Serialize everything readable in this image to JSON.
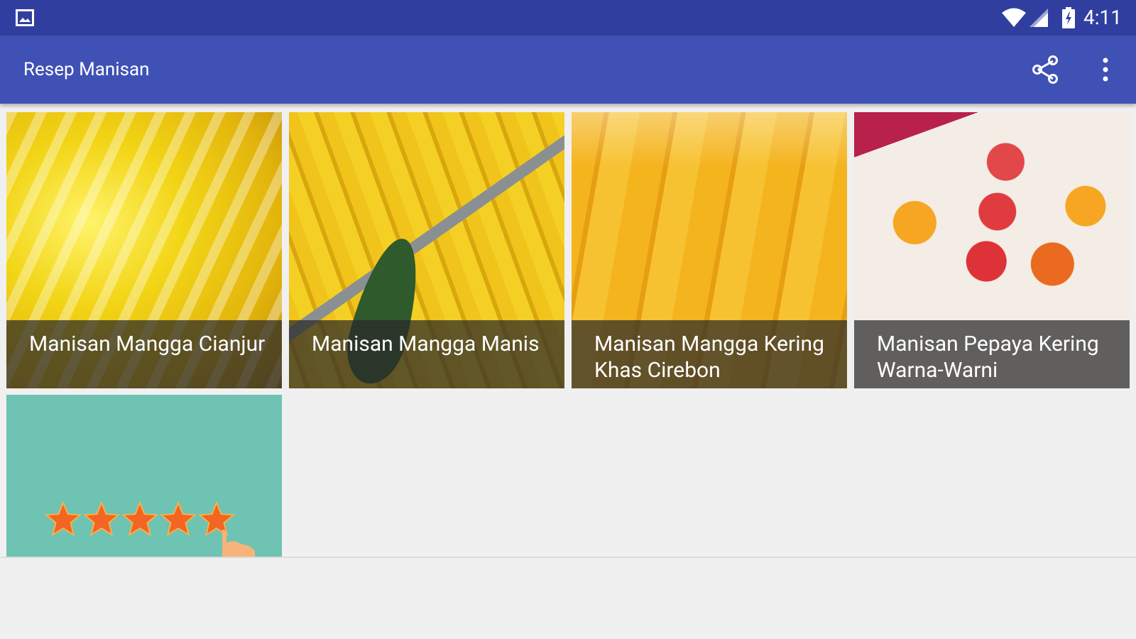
{
  "status_bar": {
    "time": "4:11",
    "icons": [
      "gallery-icon",
      "wifi-icon",
      "signal-icon",
      "battery-icon"
    ]
  },
  "app_bar": {
    "title": "Resep Manisan",
    "actions": [
      "share-icon",
      "more-vert-icon"
    ]
  },
  "recipes": [
    {
      "title": "Manisan Mangga Cianjur"
    },
    {
      "title": "Manisan Mangga Manis"
    },
    {
      "title": "Manisan Mangga Kering Khas Cirebon"
    },
    {
      "title": "Manisan Pepaya Kering Warna-Warni"
    }
  ],
  "rate_tile": {
    "stars": 5,
    "icons": [
      "star-icon",
      "pointing-hand-icon"
    ]
  },
  "colors": {
    "status_bar": "#303f9f",
    "app_bar": "#3f51b5",
    "background": "#f0f0f0",
    "rate_tile": "#6ec3b3",
    "star": "#f26522"
  }
}
